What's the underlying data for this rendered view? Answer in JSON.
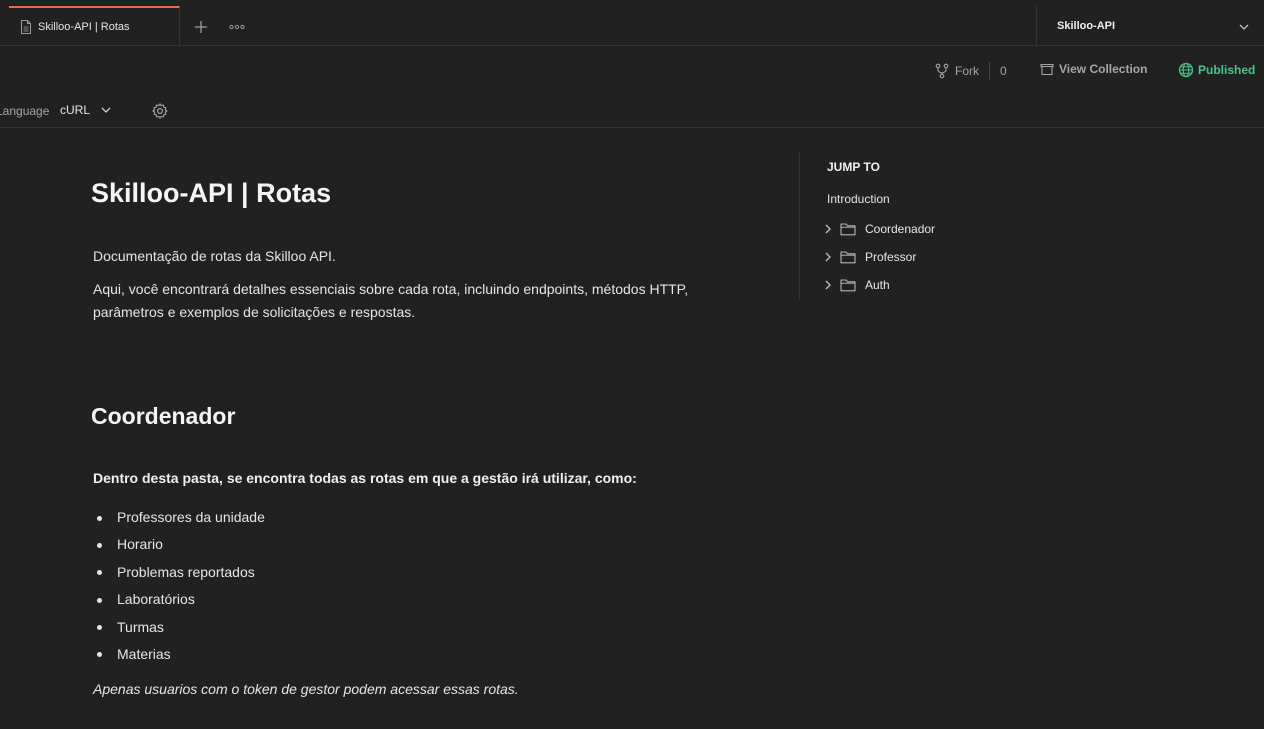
{
  "tab": {
    "label": "Skilloo-API | Rotas",
    "icon": "document-icon"
  },
  "tabbar": {
    "new_tab_icon": "plus-icon",
    "more_icon": "more-horizontal-icon"
  },
  "environment": {
    "label": "Skilloo-API"
  },
  "actions": {
    "fork_label": "Fork",
    "fork_count": "0",
    "view_collection_label": "View Collection",
    "published_label": "Published"
  },
  "language": {
    "label": "Language",
    "selected": "cURL"
  },
  "doc": {
    "title": "Skilloo-API | Rotas",
    "intro": "Documentação de rotas da Skilloo API.",
    "description": "Aqui, você encontrará detalhes essenciais sobre cada rota, incluindo endpoints, métodos HTTP, parâmetros e exemplos de solicitações e respostas."
  },
  "section": {
    "title": "Coordenador",
    "intro": "Dentro desta pasta, se encontra todas as rotas em que a gestão irá utilizar, como:",
    "items": [
      "Professores da unidade",
      "Horario",
      "Problemas reportados",
      "Laboratórios",
      "Turmas",
      "Materias"
    ],
    "note": "Apenas usuarios com o token de gestor podem acessar essas rotas."
  },
  "jump_to": {
    "heading": "JUMP TO",
    "intro": "Introduction",
    "folders": [
      "Coordenador",
      "Professor",
      "Auth"
    ]
  },
  "colors": {
    "accent": "#f26b3a",
    "published": "#4cc38a",
    "background": "#212121"
  }
}
